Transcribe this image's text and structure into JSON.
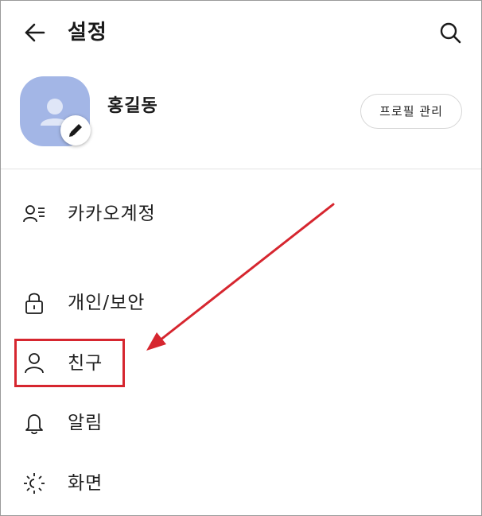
{
  "header": {
    "title": "설정",
    "back_icon": "arrow-left-icon",
    "search_icon": "search-icon"
  },
  "profile": {
    "name": "홍길동",
    "manage_button": "프로필 관리",
    "avatar_color": "#a3b6e6",
    "edit_icon": "pencil-icon"
  },
  "menu": {
    "items": [
      {
        "label": "카카오계정",
        "icon": "account-list-icon"
      },
      {
        "label": "개인/보안",
        "icon": "lock-icon"
      },
      {
        "label": "친구",
        "icon": "person-icon"
      },
      {
        "label": "알림",
        "icon": "bell-icon"
      },
      {
        "label": "화면",
        "icon": "brightness-icon"
      }
    ]
  },
  "annotation": {
    "highlight_color": "#d6262f",
    "highlighted_item": "친구"
  }
}
